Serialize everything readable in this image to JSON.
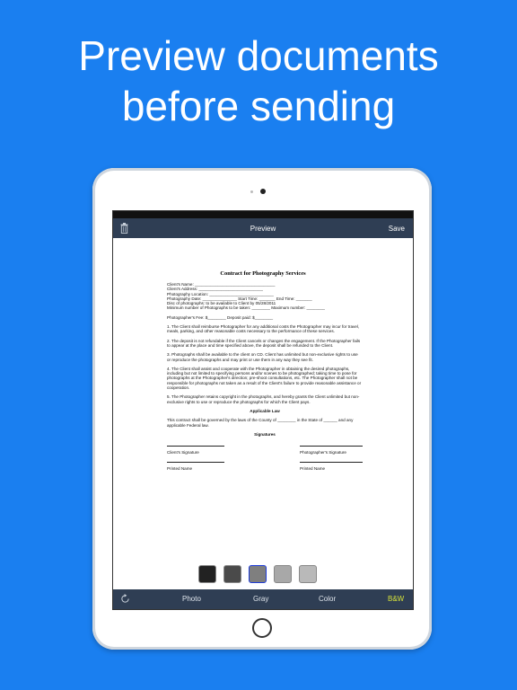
{
  "headline": {
    "line1": "Preview documents",
    "line2": "before sending"
  },
  "nav": {
    "title": "Preview",
    "save_label": "Save",
    "trash_icon": "trash-icon"
  },
  "document": {
    "title": "Contract for Photography Services",
    "fields": [
      "Client's Name: ___________________________________",
      "Client's Address: ____________________________",
      "Photography Location: ____________________________",
      "Photography Date: _______________ Start Time: _______ End Time: _______",
      "Disc of photographs: to be available to Client by 05/28/2011",
      "Minimum number of Photographs to be taken: ________ Maximum number: ________",
      "Photographer's Fee: $________ Deposit paid: $________"
    ],
    "clauses": [
      "1. The Client shall reimburse Photographer for any additional costs the Photographer may incur for travel, meals, parking, and other reasonable costs necessary to the performance of these services.",
      "2. The deposit is not refundable if the Client cancels or changes the engagement. If the Photographer fails to appear at the place and time specified above, the deposit shall be refunded to the Client.",
      "3. Photographs shall be available to the client on CD. Client has unlimited but non-exclusive rights to use or reproduce the photographs and may print or use them in any way they see fit.",
      "4. The Client shall assist and cooperate with the Photographer in obtaining the desired photographs, including but not limited to specifying persons and/or scenes to be photographed; taking time to pose for photographs at the Photographer's direction; pre-shoot consultations, etc. The Photographer shall not be responsible for photographs not taken as a result of the Client's failure to provide reasonable assistance or cooperation.",
      "5. The Photographer retains copyright in the photographs, and hereby grants the Client unlimited but non-exclusive rights to use or reproduce the photographs for which the Client pays."
    ],
    "law_heading": "Applicable Law",
    "law_text": "This contract shall be governed by the laws of the County of ________ in the State of ______ and any applicable Federal law.",
    "signatures_heading": "Signatures",
    "client_signature": "Client's Signature",
    "photographer_signature": "Photographer's Signature",
    "printed_name_left": "Printed Name",
    "printed_name_right": "Printed Name"
  },
  "swatches": [
    {
      "color": "#222222",
      "selected": false
    },
    {
      "color": "#4a4a4a",
      "selected": false
    },
    {
      "color": "#7f7f7f",
      "selected": true
    },
    {
      "color": "#a8a8a8",
      "selected": false
    },
    {
      "color": "#b9b9b9",
      "selected": false
    }
  ],
  "tabbar": {
    "refresh_icon": "rotate-icon",
    "photo": "Photo",
    "gray": "Gray",
    "color": "Color",
    "bw": "B&W",
    "active_color": "#d7e33a"
  }
}
